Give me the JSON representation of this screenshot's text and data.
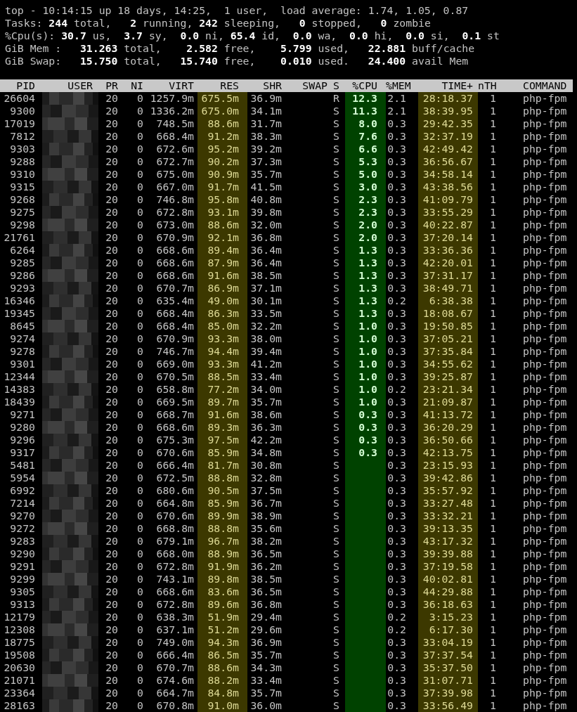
{
  "summary": [
    "top - 10:14:15 up 18 days, 14:25,  1 user,  load average: 1.74, 1.05, 0.87",
    "Tasks: **244** total,   **2** running, **242** sleeping,   **0** stopped,   **0** zombie",
    "%Cpu(s): **30.7** us,  **3.7** sy,  **0.0** ni, **65.4** id,  **0.0** wa,  **0.0** hi,  **0.0** si,  **0.1** st",
    "GiB Mem :   **31.263** total,    **2.582** free,    **5.799** used,   **22.881** buff/cache",
    "GiB Swap:   **15.750** total,   **15.740** free,    **0.010** used.   **24.400** avail Mem"
  ],
  "table": {
    "columns": [
      {
        "label": "PID",
        "kind": "plain"
      },
      {
        "label": "USER",
        "kind": "pixelated"
      },
      {
        "label": "PR",
        "kind": "plain"
      },
      {
        "label": "NI",
        "kind": "plain"
      },
      {
        "label": "VIRT",
        "kind": "plain"
      },
      {
        "label": "RES",
        "kind": "yellow"
      },
      {
        "label": "SHR",
        "kind": "plain"
      },
      {
        "label": "SWAP",
        "kind": "plain"
      },
      {
        "label": "S",
        "kind": "plain"
      },
      {
        "label": "%CPU",
        "kind": "green"
      },
      {
        "label": "%MEM",
        "kind": "plain"
      },
      {
        "label": "TIME+",
        "kind": "yellow"
      },
      {
        "label": "nTH",
        "kind": "plain"
      },
      {
        "label": "COMMAND",
        "kind": "plain"
      }
    ],
    "rows": [
      {
        "pid": "26604",
        "pr": "20",
        "ni": "0",
        "virt": "1257.9m",
        "res": "675.5m",
        "shr": "36.9m",
        "s": "R",
        "cpu": "12.3",
        "mem": "2.1",
        "time": "28:18.37",
        "nth": "1",
        "command": "php-fpm"
      },
      {
        "pid": "9300",
        "pr": "20",
        "ni": "0",
        "virt": "1336.2m",
        "res": "675.0m",
        "shr": "34.1m",
        "s": "S",
        "cpu": "11.3",
        "mem": "2.1",
        "time": "38:39.95",
        "nth": "1",
        "command": "php-fpm"
      },
      {
        "pid": "17019",
        "pr": "20",
        "ni": "0",
        "virt": "748.5m",
        "res": "88.6m",
        "shr": "31.7m",
        "s": "S",
        "cpu": "8.0",
        "mem": "0.3",
        "time": "29:42.35",
        "nth": "1",
        "command": "php-fpm"
      },
      {
        "pid": "7812",
        "pr": "20",
        "ni": "0",
        "virt": "668.4m",
        "res": "91.2m",
        "shr": "38.3m",
        "s": "S",
        "cpu": "7.6",
        "mem": "0.3",
        "time": "32:37.19",
        "nth": "1",
        "command": "php-fpm"
      },
      {
        "pid": "9303",
        "pr": "20",
        "ni": "0",
        "virt": "672.6m",
        "res": "95.2m",
        "shr": "39.2m",
        "s": "S",
        "cpu": "6.6",
        "mem": "0.3",
        "time": "42:49.42",
        "nth": "1",
        "command": "php-fpm"
      },
      {
        "pid": "9288",
        "pr": "20",
        "ni": "0",
        "virt": "672.7m",
        "res": "90.2m",
        "shr": "37.3m",
        "s": "S",
        "cpu": "5.3",
        "mem": "0.3",
        "time": "36:56.67",
        "nth": "1",
        "command": "php-fpm"
      },
      {
        "pid": "9310",
        "pr": "20",
        "ni": "0",
        "virt": "675.0m",
        "res": "90.9m",
        "shr": "35.7m",
        "s": "S",
        "cpu": "5.0",
        "mem": "0.3",
        "time": "34:58.14",
        "nth": "1",
        "command": "php-fpm"
      },
      {
        "pid": "9315",
        "pr": "20",
        "ni": "0",
        "virt": "667.0m",
        "res": "91.7m",
        "shr": "41.5m",
        "s": "S",
        "cpu": "3.0",
        "mem": "0.3",
        "time": "43:38.56",
        "nth": "1",
        "command": "php-fpm"
      },
      {
        "pid": "9268",
        "pr": "20",
        "ni": "0",
        "virt": "746.8m",
        "res": "95.8m",
        "shr": "40.8m",
        "s": "S",
        "cpu": "2.3",
        "mem": "0.3",
        "time": "41:09.79",
        "nth": "1",
        "command": "php-fpm"
      },
      {
        "pid": "9275",
        "pr": "20",
        "ni": "0",
        "virt": "672.8m",
        "res": "93.1m",
        "shr": "39.8m",
        "s": "S",
        "cpu": "2.3",
        "mem": "0.3",
        "time": "33:55.29",
        "nth": "1",
        "command": "php-fpm"
      },
      {
        "pid": "9298",
        "pr": "20",
        "ni": "0",
        "virt": "673.0m",
        "res": "88.6m",
        "shr": "32.0m",
        "s": "S",
        "cpu": "2.0",
        "mem": "0.3",
        "time": "40:22.87",
        "nth": "1",
        "command": "php-fpm"
      },
      {
        "pid": "21761",
        "pr": "20",
        "ni": "0",
        "virt": "670.9m",
        "res": "92.1m",
        "shr": "36.8m",
        "s": "S",
        "cpu": "2.0",
        "mem": "0.3",
        "time": "37:20.14",
        "nth": "1",
        "command": "php-fpm"
      },
      {
        "pid": "6264",
        "pr": "20",
        "ni": "0",
        "virt": "668.6m",
        "res": "89.4m",
        "shr": "36.4m",
        "s": "S",
        "cpu": "1.3",
        "mem": "0.3",
        "time": "33:36.36",
        "nth": "1",
        "command": "php-fpm"
      },
      {
        "pid": "9285",
        "pr": "20",
        "ni": "0",
        "virt": "668.6m",
        "res": "87.9m",
        "shr": "36.4m",
        "s": "S",
        "cpu": "1.3",
        "mem": "0.3",
        "time": "42:20.01",
        "nth": "1",
        "command": "php-fpm"
      },
      {
        "pid": "9286",
        "pr": "20",
        "ni": "0",
        "virt": "668.6m",
        "res": "91.6m",
        "shr": "38.5m",
        "s": "S",
        "cpu": "1.3",
        "mem": "0.3",
        "time": "37:31.17",
        "nth": "1",
        "command": "php-fpm"
      },
      {
        "pid": "9293",
        "pr": "20",
        "ni": "0",
        "virt": "670.7m",
        "res": "86.9m",
        "shr": "37.1m",
        "s": "S",
        "cpu": "1.3",
        "mem": "0.3",
        "time": "38:49.71",
        "nth": "1",
        "command": "php-fpm"
      },
      {
        "pid": "16346",
        "pr": "20",
        "ni": "0",
        "virt": "635.4m",
        "res": "49.0m",
        "shr": "30.1m",
        "s": "S",
        "cpu": "1.3",
        "mem": "0.2",
        "time": "6:38.38",
        "nth": "1",
        "command": "php-fpm"
      },
      {
        "pid": "19345",
        "pr": "20",
        "ni": "0",
        "virt": "668.4m",
        "res": "86.3m",
        "shr": "33.5m",
        "s": "S",
        "cpu": "1.3",
        "mem": "0.3",
        "time": "18:08.67",
        "nth": "1",
        "command": "php-fpm"
      },
      {
        "pid": "8645",
        "pr": "20",
        "ni": "0",
        "virt": "668.4m",
        "res": "85.0m",
        "shr": "32.2m",
        "s": "S",
        "cpu": "1.0",
        "mem": "0.3",
        "time": "19:50.85",
        "nth": "1",
        "command": "php-fpm"
      },
      {
        "pid": "9274",
        "pr": "20",
        "ni": "0",
        "virt": "670.9m",
        "res": "93.3m",
        "shr": "38.0m",
        "s": "S",
        "cpu": "1.0",
        "mem": "0.3",
        "time": "37:05.21",
        "nth": "1",
        "command": "php-fpm"
      },
      {
        "pid": "9278",
        "pr": "20",
        "ni": "0",
        "virt": "746.7m",
        "res": "94.4m",
        "shr": "39.4m",
        "s": "S",
        "cpu": "1.0",
        "mem": "0.3",
        "time": "37:35.84",
        "nth": "1",
        "command": "php-fpm"
      },
      {
        "pid": "9301",
        "pr": "20",
        "ni": "0",
        "virt": "669.0m",
        "res": "93.3m",
        "shr": "41.2m",
        "s": "S",
        "cpu": "1.0",
        "mem": "0.3",
        "time": "34:55.62",
        "nth": "1",
        "command": "php-fpm"
      },
      {
        "pid": "12344",
        "pr": "20",
        "ni": "0",
        "virt": "670.5m",
        "res": "88.5m",
        "shr": "33.4m",
        "s": "S",
        "cpu": "1.0",
        "mem": "0.3",
        "time": "39:25.87",
        "nth": "1",
        "command": "php-fpm"
      },
      {
        "pid": "14383",
        "pr": "20",
        "ni": "0",
        "virt": "658.8m",
        "res": "77.2m",
        "shr": "34.0m",
        "s": "S",
        "cpu": "1.0",
        "mem": "0.2",
        "time": "23:21.34",
        "nth": "1",
        "command": "php-fpm"
      },
      {
        "pid": "18439",
        "pr": "20",
        "ni": "0",
        "virt": "669.5m",
        "res": "89.7m",
        "shr": "35.7m",
        "s": "S",
        "cpu": "1.0",
        "mem": "0.3",
        "time": "21:09.87",
        "nth": "1",
        "command": "php-fpm"
      },
      {
        "pid": "9271",
        "pr": "20",
        "ni": "0",
        "virt": "668.7m",
        "res": "91.6m",
        "shr": "38.6m",
        "s": "S",
        "cpu": "0.3",
        "mem": "0.3",
        "time": "41:13.72",
        "nth": "1",
        "command": "php-fpm"
      },
      {
        "pid": "9280",
        "pr": "20",
        "ni": "0",
        "virt": "668.6m",
        "res": "89.3m",
        "shr": "36.3m",
        "s": "S",
        "cpu": "0.3",
        "mem": "0.3",
        "time": "36:20.29",
        "nth": "1",
        "command": "php-fpm"
      },
      {
        "pid": "9296",
        "pr": "20",
        "ni": "0",
        "virt": "675.3m",
        "res": "97.5m",
        "shr": "42.2m",
        "s": "S",
        "cpu": "0.3",
        "mem": "0.3",
        "time": "36:50.66",
        "nth": "1",
        "command": "php-fpm"
      },
      {
        "pid": "9317",
        "pr": "20",
        "ni": "0",
        "virt": "670.6m",
        "res": "85.9m",
        "shr": "34.8m",
        "s": "S",
        "cpu": "0.3",
        "mem": "0.3",
        "time": "42:13.75",
        "nth": "1",
        "command": "php-fpm"
      },
      {
        "pid": "5481",
        "pr": "20",
        "ni": "0",
        "virt": "666.4m",
        "res": "81.7m",
        "shr": "30.8m",
        "s": "S",
        "mem": "0.3",
        "time": "23:15.93",
        "nth": "1",
        "command": "php-fpm"
      },
      {
        "pid": "5954",
        "pr": "20",
        "ni": "0",
        "virt": "672.5m",
        "res": "88.8m",
        "shr": "32.8m",
        "s": "S",
        "mem": "0.3",
        "time": "39:42.86",
        "nth": "1",
        "command": "php-fpm"
      },
      {
        "pid": "6992",
        "pr": "20",
        "ni": "0",
        "virt": "680.6m",
        "res": "90.5m",
        "shr": "37.5m",
        "s": "S",
        "mem": "0.3",
        "time": "35:57.92",
        "nth": "1",
        "command": "php-fpm"
      },
      {
        "pid": "7214",
        "pr": "20",
        "ni": "0",
        "virt": "664.8m",
        "res": "85.9m",
        "shr": "36.7m",
        "s": "S",
        "mem": "0.3",
        "time": "33:27.48",
        "nth": "1",
        "command": "php-fpm"
      },
      {
        "pid": "9270",
        "pr": "20",
        "ni": "0",
        "virt": "670.6m",
        "res": "89.9m",
        "shr": "38.9m",
        "s": "S",
        "mem": "0.3",
        "time": "33:32.21",
        "nth": "1",
        "command": "php-fpm"
      },
      {
        "pid": "9272",
        "pr": "20",
        "ni": "0",
        "virt": "668.8m",
        "res": "88.8m",
        "shr": "35.6m",
        "s": "S",
        "mem": "0.3",
        "time": "39:13.35",
        "nth": "1",
        "command": "php-fpm"
      },
      {
        "pid": "9283",
        "pr": "20",
        "ni": "0",
        "virt": "679.1m",
        "res": "96.7m",
        "shr": "38.2m",
        "s": "S",
        "mem": "0.3",
        "time": "43:17.32",
        "nth": "1",
        "command": "php-fpm"
      },
      {
        "pid": "9290",
        "pr": "20",
        "ni": "0",
        "virt": "668.0m",
        "res": "88.9m",
        "shr": "36.5m",
        "s": "S",
        "mem": "0.3",
        "time": "39:39.88",
        "nth": "1",
        "command": "php-fpm"
      },
      {
        "pid": "9291",
        "pr": "20",
        "ni": "0",
        "virt": "672.8m",
        "res": "91.9m",
        "shr": "36.2m",
        "s": "S",
        "mem": "0.3",
        "time": "37:19.58",
        "nth": "1",
        "command": "php-fpm"
      },
      {
        "pid": "9299",
        "pr": "20",
        "ni": "0",
        "virt": "743.1m",
        "res": "89.8m",
        "shr": "38.5m",
        "s": "S",
        "mem": "0.3",
        "time": "40:02.81",
        "nth": "1",
        "command": "php-fpm"
      },
      {
        "pid": "9305",
        "pr": "20",
        "ni": "0",
        "virt": "668.6m",
        "res": "83.6m",
        "shr": "36.5m",
        "s": "S",
        "mem": "0.3",
        "time": "44:29.88",
        "nth": "1",
        "command": "php-fpm"
      },
      {
        "pid": "9313",
        "pr": "20",
        "ni": "0",
        "virt": "672.8m",
        "res": "89.6m",
        "shr": "36.8m",
        "s": "S",
        "mem": "0.3",
        "time": "36:18.63",
        "nth": "1",
        "command": "php-fpm"
      },
      {
        "pid": "12179",
        "pr": "20",
        "ni": "0",
        "virt": "638.3m",
        "res": "51.9m",
        "shr": "29.4m",
        "s": "S",
        "mem": "0.2",
        "time": "3:15.23",
        "nth": "1",
        "command": "php-fpm"
      },
      {
        "pid": "12308",
        "pr": "20",
        "ni": "0",
        "virt": "637.1m",
        "res": "51.2m",
        "shr": "29.6m",
        "s": "S",
        "mem": "0.2",
        "time": "6:17.30",
        "nth": "1",
        "command": "php-fpm"
      },
      {
        "pid": "18775",
        "pr": "20",
        "ni": "0",
        "virt": "749.0m",
        "res": "94.3m",
        "shr": "36.9m",
        "s": "S",
        "mem": "0.3",
        "time": "33:04.19",
        "nth": "1",
        "command": "php-fpm"
      },
      {
        "pid": "19508",
        "pr": "20",
        "ni": "0",
        "virt": "666.4m",
        "res": "86.5m",
        "shr": "35.7m",
        "s": "S",
        "mem": "0.3",
        "time": "37:37.54",
        "nth": "1",
        "command": "php-fpm"
      },
      {
        "pid": "20630",
        "pr": "20",
        "ni": "0",
        "virt": "670.7m",
        "res": "88.6m",
        "shr": "34.3m",
        "s": "S",
        "mem": "0.3",
        "time": "35:37.50",
        "nth": "1",
        "command": "php-fpm"
      },
      {
        "pid": "21071",
        "pr": "20",
        "ni": "0",
        "virt": "674.6m",
        "res": "88.2m",
        "shr": "33.4m",
        "s": "S",
        "mem": "0.3",
        "time": "31:07.71",
        "nth": "1",
        "command": "php-fpm"
      },
      {
        "pid": "23364",
        "pr": "20",
        "ni": "0",
        "virt": "664.7m",
        "res": "84.8m",
        "shr": "35.7m",
        "s": "S",
        "mem": "0.3",
        "time": "37:39.98",
        "nth": "1",
        "command": "php-fpm"
      },
      {
        "pid": "28163",
        "pr": "20",
        "ni": "0",
        "virt": "670.8m",
        "res": "91.0m",
        "shr": "36.0m",
        "s": "S",
        "mem": "0.3",
        "time": "33:56.49",
        "nth": "1",
        "command": "php-fpm"
      }
    ]
  }
}
